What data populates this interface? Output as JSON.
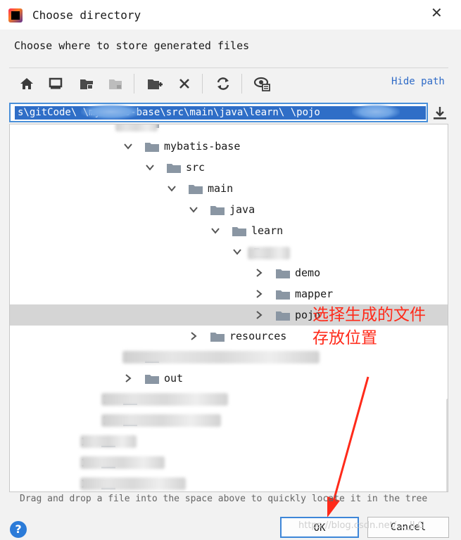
{
  "window": {
    "title": "Choose directory",
    "subtitle": "Choose where to store generated files"
  },
  "toolbar": {
    "buttons": [
      "home-icon",
      "desktop-icon",
      "project-folder-icon",
      "module-folder-icon",
      "new-folder-icon",
      "delete-icon",
      "refresh-icon",
      "show-hidden-icon"
    ],
    "hide_path_label": "Hide path"
  },
  "path": {
    "value": "s\\gitCode\\ \\mybatis-base\\src\\main\\java\\learn\\ \\pojo"
  },
  "tree": {
    "items": [
      {
        "label": "",
        "state": "partial"
      },
      {
        "label": "mybatis-base",
        "state": "expanded"
      },
      {
        "label": "src",
        "state": "expanded"
      },
      {
        "label": "main",
        "state": "expanded"
      },
      {
        "label": "java",
        "state": "expanded"
      },
      {
        "label": "learn",
        "state": "expanded"
      },
      {
        "label": "",
        "state": "expanded"
      },
      {
        "label": "demo",
        "state": "collapsed"
      },
      {
        "label": "mapper",
        "state": "collapsed"
      },
      {
        "label": "pojo",
        "state": "collapsed",
        "selected": true
      },
      {
        "label": "resources",
        "state": "collapsed"
      },
      {
        "label": "",
        "state": "collapsed"
      },
      {
        "label": "out",
        "state": "collapsed"
      },
      {
        "label": "",
        "state": "collapsed"
      },
      {
        "label": "",
        "state": "collapsed"
      },
      {
        "label": "",
        "state": "collapsed"
      },
      {
        "label": "",
        "state": "collapsed"
      },
      {
        "label": "",
        "state": "collapsed"
      }
    ]
  },
  "annotation": {
    "line1": "选择生成的文件",
    "line2": "存放位置",
    "color": "#ff2a1a"
  },
  "hint": "Drag and drop a file into the space above to quickly locate it in the tree",
  "footer": {
    "help": "?",
    "ok": "OK",
    "cancel": "Cancel",
    "watermark": "https://blog.csdn.net/..._JLG"
  },
  "colors": {
    "selection": "#2f6ec7",
    "link": "#2f6bc7",
    "folder": "#8a96a3"
  }
}
